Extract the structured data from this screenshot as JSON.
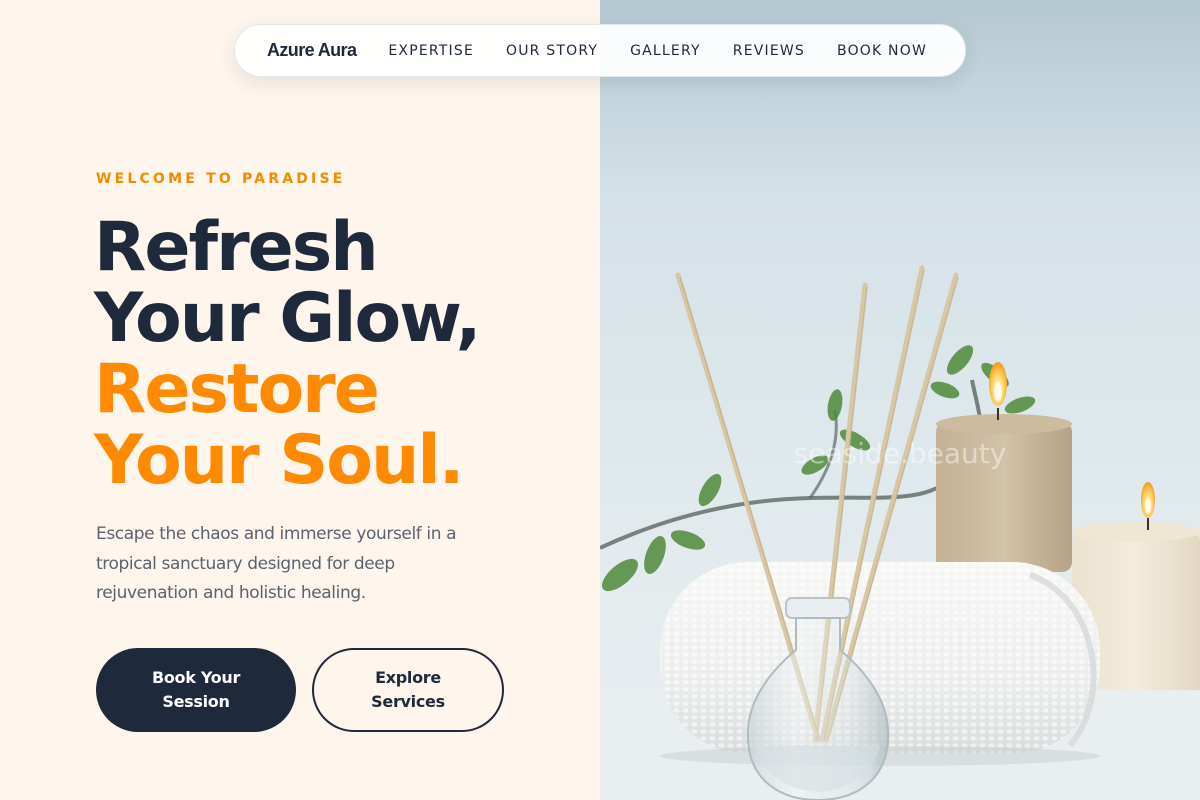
{
  "nav": {
    "brand": "Azure Aura",
    "links": [
      "EXPERTISE",
      "OUR STORY",
      "GALLERY",
      "REVIEWS",
      "BOOK NOW"
    ]
  },
  "hero": {
    "eyebrow": "WELCOME TO PARADISE",
    "headline_dark": [
      "Refresh",
      "Your Glow,"
    ],
    "headline_accent": [
      "Restore",
      "Your Soul."
    ],
    "description": "Escape the chaos and immerse yourself in a tropical sanctuary designed for deep rejuvenation and holistic healing.",
    "primary_button": "Book Your Session",
    "secondary_button": "Explore Services"
  },
  "image": {
    "subject": "spa-still-life-photo",
    "watermark": "seaside.beauty"
  },
  "colors": {
    "background": "#fef5ec",
    "navy": "#1e293b",
    "accent": "#ff8a00",
    "body_text": "#5b6270"
  }
}
